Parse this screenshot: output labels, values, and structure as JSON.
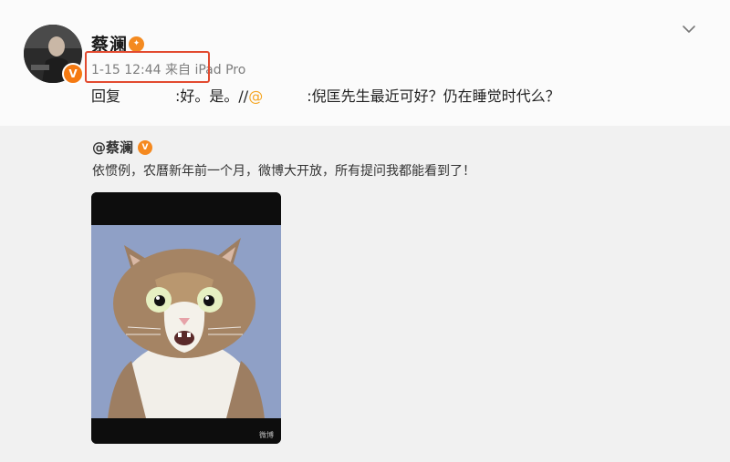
{
  "post": {
    "author": "蔡澜",
    "timestamp": "1-15 12:44 来自 iPad Pro",
    "reply": {
      "prefix": "回复",
      "middle": ":好。是。//",
      "mention_at": "@",
      "tail": ":倪匡先生最近可好？仍在睡觉时代么？"
    }
  },
  "quoted": {
    "author": "@蔡澜",
    "text": "依惯例，农曆新年前一个月，微博大开放，所有提问我都能看到了！",
    "image_watermark": "微博"
  },
  "colors": {
    "highlight_box": "#e24a2f",
    "verified_badge": "#f5891f",
    "mention": "#f5a623"
  },
  "icons": {
    "expand": "chevron-down-icon",
    "verified": "verified-badge-icon"
  }
}
